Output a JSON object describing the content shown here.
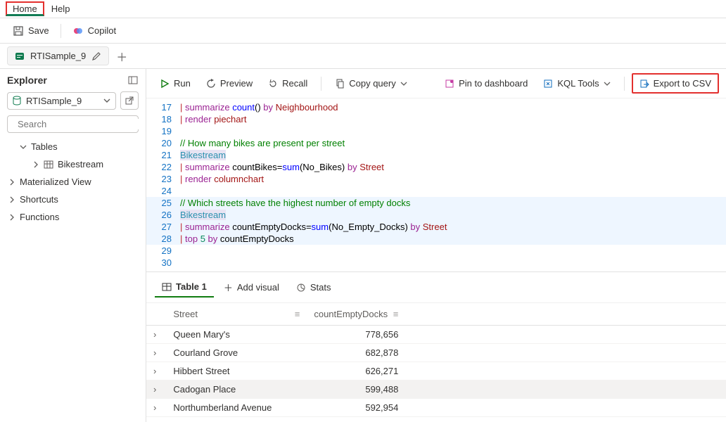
{
  "menubar": {
    "home": "Home",
    "help": "Help"
  },
  "toolbar": {
    "save": "Save",
    "copilot": "Copilot"
  },
  "tabs": {
    "file": "RTISample_9"
  },
  "explorer": {
    "title": "Explorer",
    "db": "RTISample_9",
    "search_placeholder": "Search",
    "tree": {
      "tables": "Tables",
      "bikestream": "Bikestream",
      "matview": "Materialized View",
      "shortcuts": "Shortcuts",
      "functions": "Functions"
    }
  },
  "actions": {
    "run": "Run",
    "preview": "Preview",
    "recall": "Recall",
    "copy": "Copy query",
    "pin": "Pin to dashboard",
    "kql": "KQL Tools",
    "export": "Export to CSV"
  },
  "code": {
    "l17a": "| ",
    "l17b": "summarize ",
    "l17c": "count",
    "l17d": "() ",
    "l17e": "by ",
    "l17f": "Neighbourhood",
    "l18a": "| ",
    "l18b": "render ",
    "l18c": "piechart",
    "l20": "// How many bikes are present per street",
    "l21": "Bikestream",
    "l22a": "| ",
    "l22b": "summarize ",
    "l22c": "countBikes=",
    "l22d": "sum",
    "l22e": "(No_Bikes) ",
    "l22f": "by ",
    "l22g": "Street",
    "l23a": "| ",
    "l23b": "render ",
    "l23c": "columnchart",
    "l25": "// Which streets have the highest number of empty docks",
    "l26": "Bikestream",
    "l27a": "| ",
    "l27b": "summarize ",
    "l27c": "countEmptyDocks=",
    "l27d": "sum",
    "l27e": "(No_Empty_Docks) ",
    "l27f": "by ",
    "l27g": "Street",
    "l28a": "| ",
    "l28b": "top ",
    "l28c": "5",
    "l28d": " by ",
    "l28e": "countEmptyDocks"
  },
  "results": {
    "tab_table": "Table 1",
    "tab_addvisual": "Add visual",
    "tab_stats": "Stats",
    "cols": {
      "street": "Street",
      "count": "countEmptyDocks"
    },
    "rows": [
      {
        "street": "Queen Mary's",
        "count": "778,656"
      },
      {
        "street": "Courland Grove",
        "count": "682,878"
      },
      {
        "street": "Hibbert Street",
        "count": "626,271"
      },
      {
        "street": "Cadogan Place",
        "count": "599,488"
      },
      {
        "street": "Northumberland Avenue",
        "count": "592,954"
      }
    ]
  },
  "chart_data": {
    "type": "table",
    "title": "Streets with highest countEmptyDocks",
    "columns": [
      "Street",
      "countEmptyDocks"
    ],
    "rows": [
      [
        "Queen Mary's",
        778656
      ],
      [
        "Courland Grove",
        682878
      ],
      [
        "Hibbert Street",
        626271
      ],
      [
        "Cadogan Place",
        599488
      ],
      [
        "Northumberland Avenue",
        592954
      ]
    ]
  }
}
